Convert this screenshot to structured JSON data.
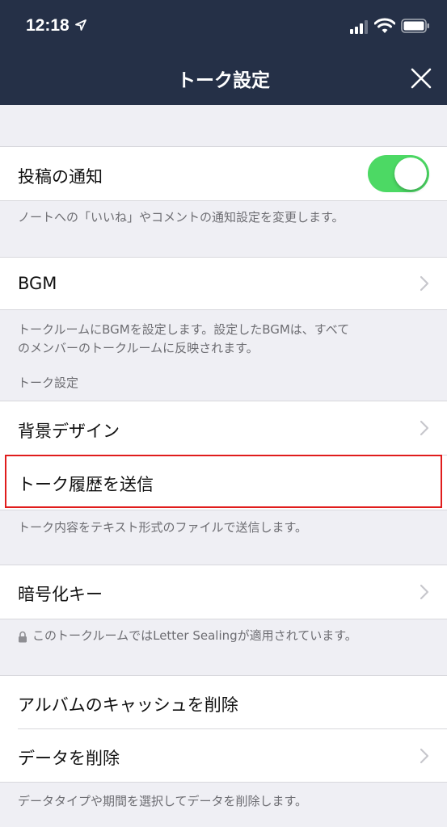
{
  "status_bar": {
    "time": "12:18"
  },
  "nav": {
    "title": "トーク設定"
  },
  "post_notification": {
    "label": "投稿の通知",
    "toggle_on": true,
    "description": "ノートへの「いいね」やコメントの通知設定を変更します。"
  },
  "bgm": {
    "label": "BGM",
    "description_line1": "トークルームにBGMを設定します。設定したBGMは、すべて",
    "description_line2": "のメンバーのトークルームに反映されます。"
  },
  "talk_settings_section": {
    "header": "トーク設定",
    "background_label": "背景デザイン",
    "send_history_label": "トーク履歴を送信",
    "send_history_description": "トーク内容をテキスト形式のファイルで送信します。"
  },
  "encryption": {
    "label": "暗号化キー",
    "description": "このトークルームではLetter Sealingが適用されています。"
  },
  "delete_section": {
    "album_cache_label": "アルバムのキャッシュを削除",
    "delete_data_label": "データを削除",
    "delete_data_description": "データタイプや期間を選択してデータを削除します。"
  },
  "colors": {
    "header_bg": "#253047",
    "toggle_on": "#4cd964",
    "highlight_border": "#e01c1c"
  }
}
